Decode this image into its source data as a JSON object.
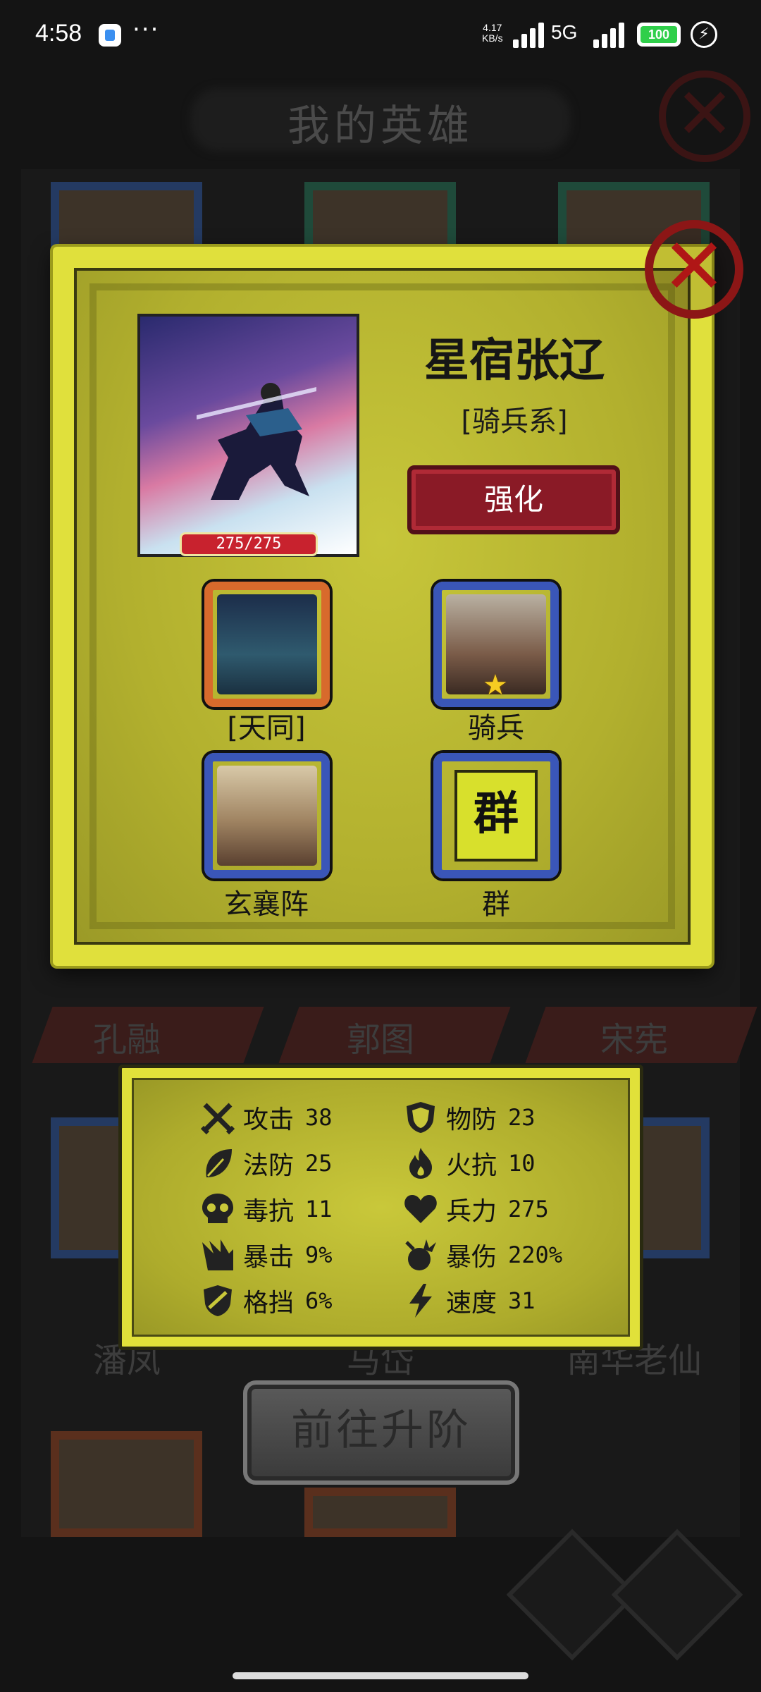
{
  "status_bar": {
    "time": "4:58",
    "more": "···",
    "net_speed_value": "4.17",
    "net_speed_unit": "KB/s",
    "network": "5G",
    "battery": "100"
  },
  "background": {
    "title": "我的英雄",
    "names_row1": [
      "孔融",
      "郭图",
      "宋宪"
    ],
    "names_row2": [
      "潘凤",
      "马岱",
      "南华老仙"
    ]
  },
  "hero": {
    "name": "星宿张辽",
    "class": "[骑兵系]",
    "hp": "275/275",
    "upgrade_label": "强化",
    "skills": [
      {
        "label": "[天同]",
        "icon": "starry-palace-icon",
        "frame": "orange"
      },
      {
        "label": "骑兵",
        "icon": "cavalry-icon",
        "frame": "blue",
        "stars": 1
      },
      {
        "label": "玄襄阵",
        "icon": "formation-icon",
        "frame": "blue"
      },
      {
        "label": "群",
        "icon": "faction-banner-icon",
        "frame": "blue",
        "banner_text": "群"
      }
    ]
  },
  "stats": {
    "left": [
      {
        "icon": "crossed-swords-icon",
        "label": "攻击",
        "value": "38"
      },
      {
        "icon": "leaf-icon",
        "label": "法防",
        "value": "25"
      },
      {
        "icon": "skull-icon",
        "label": "毒抗",
        "value": "11"
      },
      {
        "icon": "claw-icon",
        "label": "暴击",
        "value": "9%"
      },
      {
        "icon": "broken-shield-icon",
        "label": "格挡",
        "value": "6%"
      }
    ],
    "right": [
      {
        "icon": "shield-icon",
        "label": "物防",
        "value": "23"
      },
      {
        "icon": "flame-icon",
        "label": "火抗",
        "value": "10"
      },
      {
        "icon": "heart-icon",
        "label": "兵力",
        "value": "275"
      },
      {
        "icon": "explosion-icon",
        "label": "暴伤",
        "value": "220%"
      },
      {
        "icon": "lightning-icon",
        "label": "速度",
        "value": "31"
      }
    ]
  },
  "advance_button": "前往升阶",
  "colors": {
    "panel_yellow": "#e0e03c",
    "upgrade_red": "#8a1a26",
    "close_red": "#b01616",
    "hp_red": "#c8222e"
  }
}
